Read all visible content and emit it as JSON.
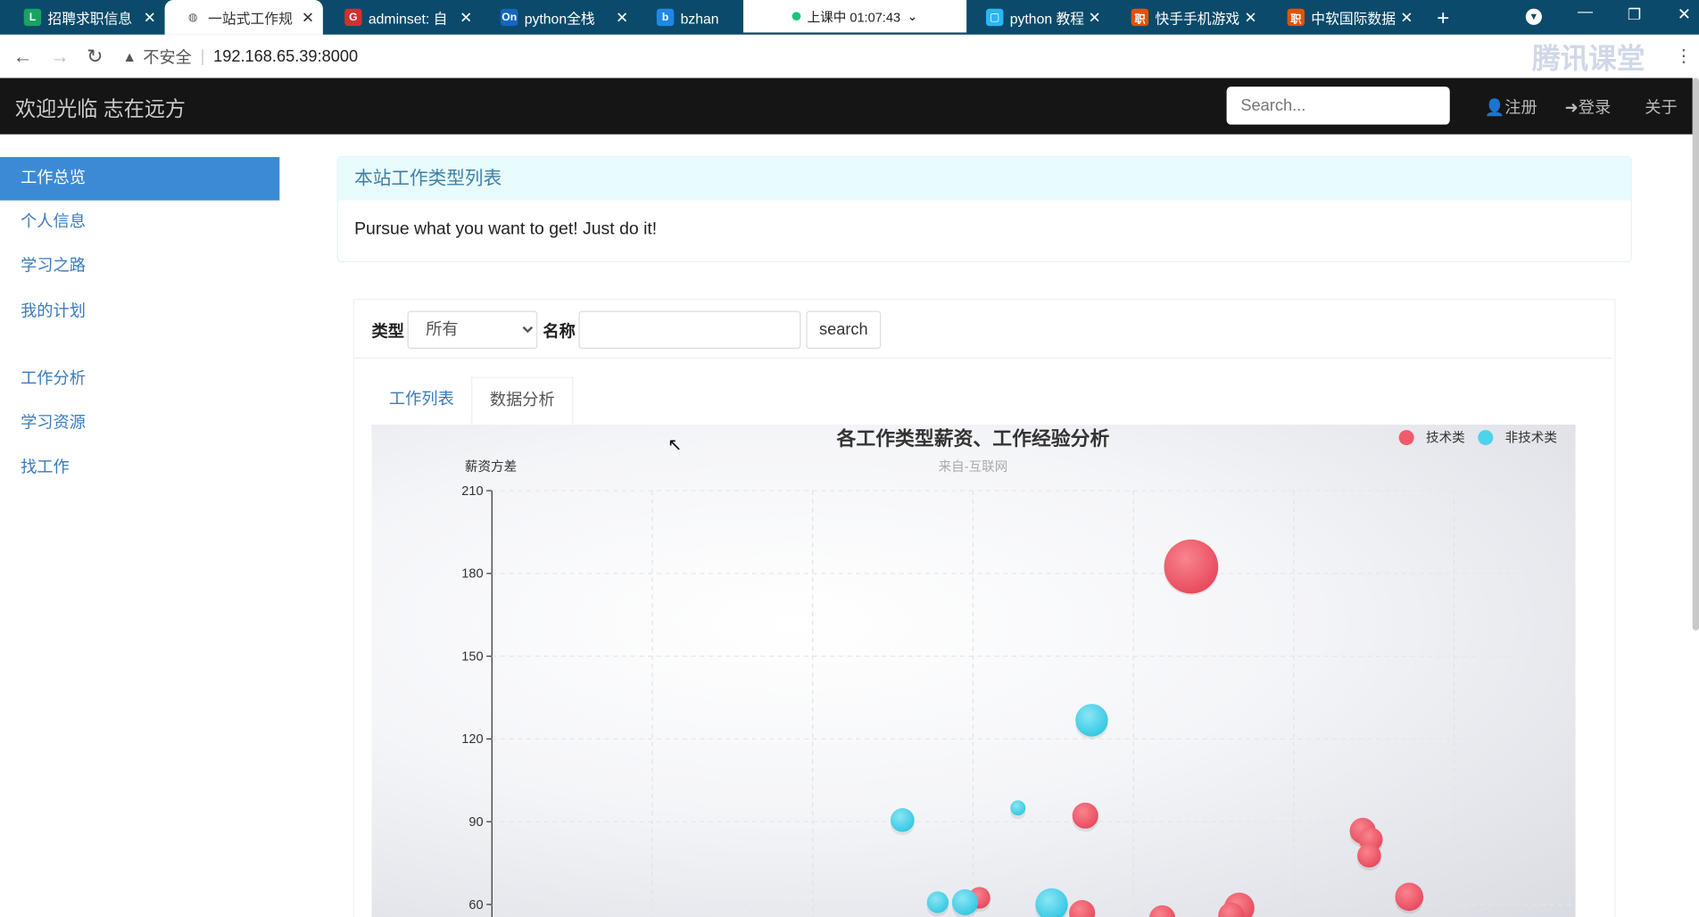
{
  "browser": {
    "tabs": [
      {
        "title": "招聘求职信息",
        "icon": "L",
        "color": "#1aa260"
      },
      {
        "title": "一站式工作规",
        "icon": "globe",
        "color": "#555",
        "active": true
      },
      {
        "title": "adminset: 自",
        "icon": "G",
        "color": "#d32f2f"
      },
      {
        "title": "python全栈",
        "icon": "On",
        "color": "#1565c0"
      },
      {
        "title": "bzhan - 国",
        "icon": "b",
        "color": "#1e88e5"
      },
      {
        "title": "python 教程",
        "icon": "▢",
        "color": "#29b6f6"
      },
      {
        "title": "快手手机游戏",
        "icon": "职",
        "color": "#e65100"
      },
      {
        "title": "中软国际数据",
        "icon": "职",
        "color": "#e65100"
      }
    ],
    "recording": "上课中 01:07:43",
    "insecure_label": "不安全",
    "url": "192.168.65.39:8000",
    "watermark": "腾讯课堂"
  },
  "navbar": {
    "brand": "欢迎光临 志在远方",
    "search_placeholder": "Search...",
    "register": "注册",
    "login": "登录",
    "about": "关于"
  },
  "sidebar": {
    "items": [
      {
        "label": "工作总览",
        "active": true
      },
      {
        "label": "个人信息"
      },
      {
        "label": "学习之路"
      },
      {
        "label": "我的计划"
      },
      {
        "label": "工作分析"
      },
      {
        "label": "学习资源"
      },
      {
        "label": "找工作"
      }
    ]
  },
  "panel": {
    "title": "本站工作类型列表",
    "text": "Pursue what you want to get!  Just do it!"
  },
  "filter": {
    "type_label": "类型",
    "type_value": "所有",
    "name_label": "名称",
    "name_value": "",
    "search_button": "search"
  },
  "tabs": [
    {
      "label": "工作列表"
    },
    {
      "label": "数据分析",
      "active": true
    }
  ],
  "chart_data": {
    "type": "scatter",
    "title": "各工作类型薪资、工作经验分析",
    "subtitle": "来自-互联网",
    "ylabel": "薪资方差",
    "yticks": [
      60,
      90,
      120,
      150,
      180,
      210
    ],
    "ylim_visible": [
      60,
      210
    ],
    "grid": true,
    "legend": "top-right",
    "series": [
      {
        "name": "技术类",
        "color": "#ef5b6c",
        "points": [
          {
            "x": 4.36,
            "y": 182.5,
            "size": 25
          },
          {
            "x": 3.7,
            "y": 92.2,
            "size": 12
          },
          {
            "x": 5.43,
            "y": 86.7,
            "size": 12
          },
          {
            "x": 5.48,
            "y": 83.6,
            "size": 11
          },
          {
            "x": 5.47,
            "y": 77.7,
            "size": 11
          },
          {
            "x": 5.72,
            "y": 62.8,
            "size": 13
          },
          {
            "x": 3.04,
            "y": 62.4,
            "size": 10
          },
          {
            "x": 3.68,
            "y": 56.9,
            "size": 12
          },
          {
            "x": 4.18,
            "y": 55.0,
            "size": 12
          },
          {
            "x": 4.66,
            "y": 58.8,
            "size": 14
          },
          {
            "x": 4.61,
            "y": 56.0,
            "size": 12
          }
        ]
      },
      {
        "name": "非技术类",
        "color": "#4dd3ea",
        "points": [
          {
            "x": 3.74,
            "y": 126.8,
            "size": 15
          },
          {
            "x": 2.56,
            "y": 90.6,
            "size": 11
          },
          {
            "x": 3.28,
            "y": 95.0,
            "size": 7
          },
          {
            "x": 2.78,
            "y": 60.8,
            "size": 10
          },
          {
            "x": 2.95,
            "y": 60.8,
            "size": 12
          },
          {
            "x": 3.49,
            "y": 60.0,
            "size": 15
          }
        ]
      }
    ]
  }
}
